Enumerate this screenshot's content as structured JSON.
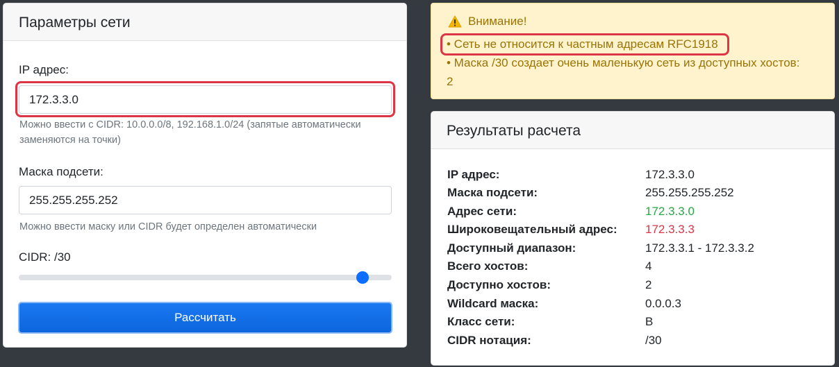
{
  "network_params": {
    "title": "Параметры сети",
    "ip_label": "IP адрес:",
    "ip_value": "172.3.3.0",
    "ip_hint_1": "Можно ввести с CIDR: 10.0.0.0/8, 192.168.1.0/24 (запятые автоматически",
    "ip_hint_2": "заменяются на точки)",
    "mask_label": "Маска подсети:",
    "mask_value": "255.255.255.252",
    "mask_hint": "Можно ввести маску или CIDR будет определен автоматически",
    "cidr_label": "CIDR: /30",
    "cidr_value": 30,
    "cidr_max": 32,
    "calc_button": "Рассчитать"
  },
  "alert": {
    "title": "Внимание!",
    "lines": [
      "• Сеть не относится к частным адресам RFC1918",
      "• Маска /30 создает очень маленькую сеть из доступных хостов:",
      "2"
    ]
  },
  "results": {
    "title": "Результаты расчета",
    "rows": [
      {
        "key": "IP адрес:",
        "value": "172.3.3.0"
      },
      {
        "key": "Маска подсети:",
        "value": "255.255.255.252"
      },
      {
        "key": "Адрес сети:",
        "value": "172.3.3.0"
      },
      {
        "key": "Широковещательный адрес:",
        "value": "172.3.3.3"
      },
      {
        "key": "Доступный диапазон:",
        "value": "172.3.3.1 - 172.3.3.2"
      },
      {
        "key": "Всего хостов:",
        "value": "4"
      },
      {
        "key": "Доступно хостов:",
        "value": "2"
      },
      {
        "key": "Wildcard маска:",
        "value": "0.0.0.3"
      },
      {
        "key": "Класс сети:",
        "value": "B"
      },
      {
        "key": "CIDR нотация:",
        "value": "/30"
      }
    ]
  },
  "colors": {
    "background": "#343a40",
    "primary": "#0d6efd",
    "success": "#28a745",
    "danger": "#dc3545",
    "warning_bg": "#fff3cd",
    "warning_text": "#997404"
  },
  "icons": {
    "alert_icon": "warning-triangle-icon"
  }
}
